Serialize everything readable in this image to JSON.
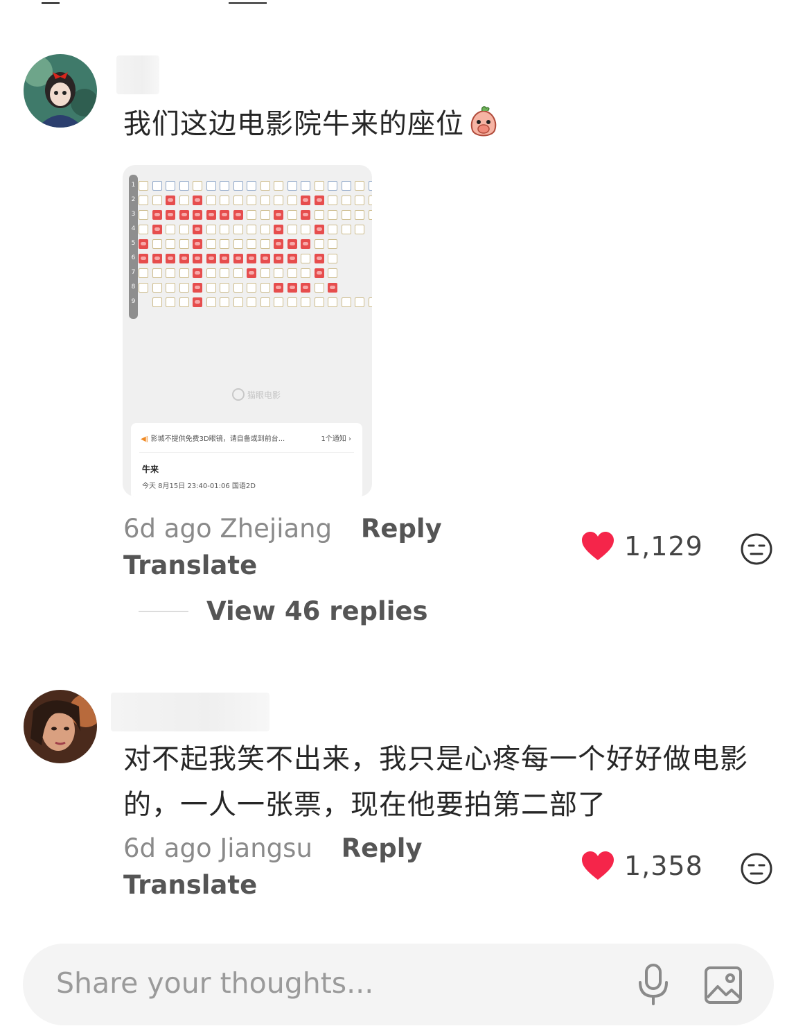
{
  "comments": [
    {
      "text": "我们这边电影院牛来的座位",
      "emoji": "peach-shy-emoji",
      "time": "6d ago",
      "location": "Zhejiang",
      "reply_label": "Reply",
      "translate_label": "Translate",
      "likes": "1,129",
      "view_replies": "View 46 replies",
      "screenshot": {
        "rows": [
          "1",
          "2",
          "3",
          "4",
          "5",
          "6",
          "7",
          "8",
          "9"
        ],
        "logo": "猫眼电影",
        "notice": "影城不提供免费3D眼镜，请自备或到前台...",
        "notice_count": "1个通知",
        "movie_title": "牛来",
        "movie_time": "今天  8月15日  23:40-01:06  国语2D"
      }
    },
    {
      "text_line1": "对不起我笑不出来，我只是心疼每一个好好做电影",
      "text_line2": "的，一人一张票，现在他要拍第二部了",
      "time": "6d ago",
      "location": "Jiangsu",
      "reply_label": "Reply",
      "translate_label": "Translate",
      "likes": "1,358"
    }
  ],
  "input": {
    "placeholder": "Share your thoughts..."
  },
  "colors": {
    "heart": "#f5254a",
    "sold_seat": "#e64d4d",
    "free_seat_border": "#cdbc8c"
  }
}
